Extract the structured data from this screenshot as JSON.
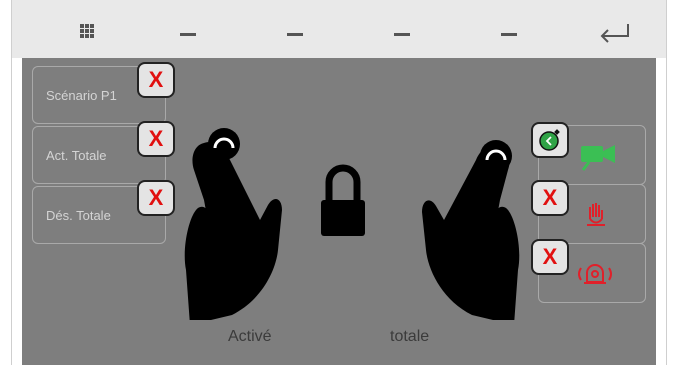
{
  "topbar": {
    "menu_icon": "grid-icon",
    "tab_placeholder": "—",
    "back_icon": "enter-return-icon"
  },
  "scenarios": [
    {
      "label": "Scénario P1",
      "remove": "X"
    },
    {
      "label": "Act. Totale",
      "remove": "X"
    },
    {
      "label": "Dés. Totale",
      "remove": "X"
    }
  ],
  "right_buttons": [
    {
      "icon": "camera-icon",
      "color": "#3bbf54",
      "status_icon": "timer-icon",
      "status_color": "#2fa346"
    },
    {
      "icon": "hand-stop-icon",
      "color": "#e0202a",
      "status": "X"
    },
    {
      "icon": "siren-alarm-icon",
      "color": "#e0202a",
      "status": "X"
    }
  ],
  "center": {
    "lock_icon": "padlock-icon",
    "gesture": "two-hand-press-icon"
  },
  "status": {
    "left": "Activé",
    "right": "totale"
  },
  "colors": {
    "stage": "#7e7e7e",
    "remove_x": "#e11010"
  }
}
